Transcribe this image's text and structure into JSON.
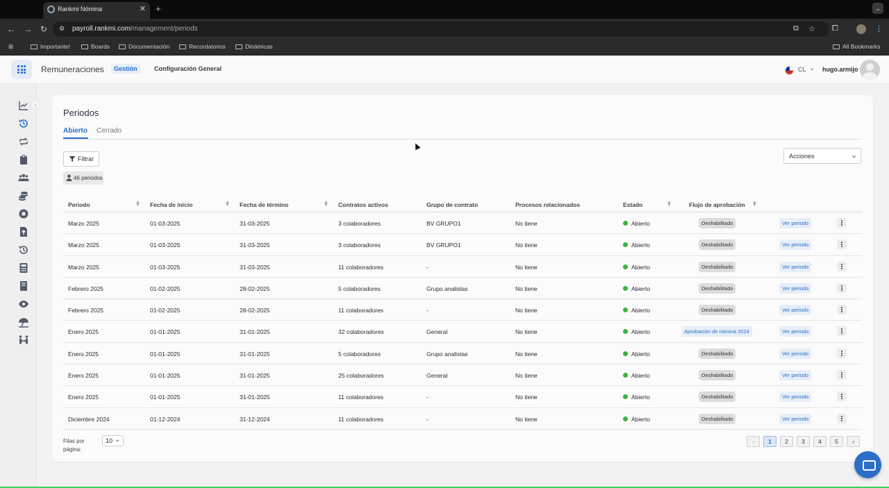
{
  "browser": {
    "tab_title": "Rankmi Nómina",
    "url_host": "payroll.rankmi.com",
    "url_path": "/management/periods",
    "bookmarks": [
      "Importante!",
      "Boards",
      "Documentación",
      "Recordatorios",
      "Dinámicas"
    ],
    "all_bookmarks": "All Bookmarks"
  },
  "app": {
    "name": "Remuneraciones",
    "nav": [
      "Gestión",
      "Configuración General"
    ],
    "country": "CL",
    "username": "hugo.armijo",
    "accent_color": "#2a6ec8"
  },
  "sidebar": {
    "icons": [
      "chart-line-icon",
      "history-icon",
      "arrows-exchange-icon",
      "clipboard-icon",
      "users-icon",
      "coins-icon",
      "stop-circle-icon",
      "upload-file-icon",
      "history-icon",
      "calculator-icon",
      "book-icon",
      "eye-icon",
      "beach-icon",
      "people-arrows-icon"
    ]
  },
  "page": {
    "title": "Periodos",
    "tabs": [
      "Abierto",
      "Cerrado"
    ],
    "filter_label": "Filtrar",
    "count_label": "46 periodos",
    "actions_label": "Acciones"
  },
  "table": {
    "columns": [
      "Periodo",
      "Fecha de inicio",
      "Fecha de término",
      "Contratos activos",
      "Grupo de contrato",
      "Procesos relacionados",
      "Estado",
      "Flujo de aprobación"
    ],
    "rows": [
      {
        "periodo": "Marzo 2025",
        "inicio": "01-03-2025",
        "termino": "31-03-2025",
        "contratos": "3 colaboradores",
        "grupo": "BV GRUPO1",
        "procesos": "No tiene",
        "estado": "Abierto",
        "flujo": "Deshabilitado",
        "flujo_active": false,
        "accion": "Ver periodo"
      },
      {
        "periodo": "Marzo 2025",
        "inicio": "01-03-2025",
        "termino": "31-03-2025",
        "contratos": "3 colaboradores",
        "grupo": "BV GRUPO1",
        "procesos": "No tiene",
        "estado": "Abierto",
        "flujo": "Deshabilitado",
        "flujo_active": false,
        "accion": "Ver periodo"
      },
      {
        "periodo": "Marzo 2025",
        "inicio": "01-03-2025",
        "termino": "31-03-2025",
        "contratos": "11 colaboradores",
        "grupo": "-",
        "procesos": "No tiene",
        "estado": "Abierto",
        "flujo": "Deshabilitado",
        "flujo_active": false,
        "accion": "Ver periodo"
      },
      {
        "periodo": "Febrero 2025",
        "inicio": "01-02-2025",
        "termino": "28-02-2025",
        "contratos": "5 colaboradores",
        "grupo": "Grupo analistas",
        "procesos": "No tiene",
        "estado": "Abierto",
        "flujo": "Deshabilitado",
        "flujo_active": false,
        "accion": "Ver periodo"
      },
      {
        "periodo": "Febrero 2025",
        "inicio": "01-02-2025",
        "termino": "28-02-2025",
        "contratos": "11 colaboradores",
        "grupo": "-",
        "procesos": "No tiene",
        "estado": "Abierto",
        "flujo": "Deshabilitado",
        "flujo_active": false,
        "accion": "Ver periodo"
      },
      {
        "periodo": "Enero 2025",
        "inicio": "01-01-2025",
        "termino": "31-01-2025",
        "contratos": "32 colaboradores",
        "grupo": "General",
        "procesos": "No tiene",
        "estado": "Abierto",
        "flujo": "Aprobación de nómina 2024",
        "flujo_active": true,
        "accion": "Ver periodo"
      },
      {
        "periodo": "Enero 2025",
        "inicio": "01-01-2025",
        "termino": "31-01-2025",
        "contratos": "5 colaboradores",
        "grupo": "Grupo analistas",
        "procesos": "No tiene",
        "estado": "Abierto",
        "flujo": "Deshabilitado",
        "flujo_active": false,
        "accion": "Ver periodo"
      },
      {
        "periodo": "Enero 2025",
        "inicio": "01-01-2025",
        "termino": "31-01-2025",
        "contratos": "25 colaboradores",
        "grupo": "General",
        "procesos": "No tiene",
        "estado": "Abierto",
        "flujo": "Deshabilitado",
        "flujo_active": false,
        "accion": "Ver periodo"
      },
      {
        "periodo": "Enero 2025",
        "inicio": "01-01-2025",
        "termino": "31-01-2025",
        "contratos": "11 colaboradores",
        "grupo": "-",
        "procesos": "No tiene",
        "estado": "Abierto",
        "flujo": "Deshabilitado",
        "flujo_active": false,
        "accion": "Ver periodo"
      },
      {
        "periodo": "Diciembre 2024",
        "inicio": "01-12-2024",
        "termino": "31-12-2024",
        "contratos": "11 colaboradores",
        "grupo": "-",
        "procesos": "No tiene",
        "estado": "Abierto",
        "flujo": "Deshabilitado",
        "flujo_active": false,
        "accion": "Ver periodo"
      }
    ],
    "status_color": "#3cb043"
  },
  "footer": {
    "rows_per_page_label": "Filas por página:",
    "rows_per_page_value": "10",
    "pages": [
      "1",
      "2",
      "3",
      "4",
      "5"
    ],
    "current_page": "1"
  }
}
